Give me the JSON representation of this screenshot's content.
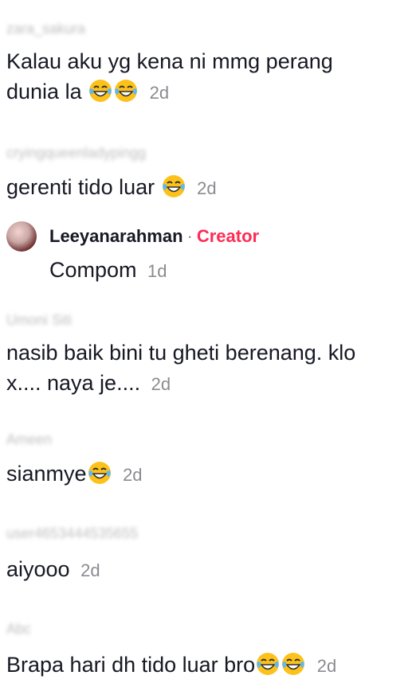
{
  "comments": [
    {
      "username": "zara_sakura",
      "text_line1": "Kalau aku yg kena ni mmg perang",
      "text_line2": "dunia la",
      "emoji": "laugh-cry",
      "time": "2d"
    },
    {
      "username": "cryingqueenladypingg",
      "text": "gerenti tido luar",
      "emoji": "laugh-cry",
      "time": "2d"
    },
    {
      "username": "Umoni Siti",
      "text_line1": "nasib baik bini tu gheti berenang. klo",
      "text_line2": "x.... naya je....",
      "time": "2d"
    },
    {
      "username": "Ameen",
      "text": "sianmye",
      "emoji": "laugh-cry",
      "time": "2d"
    },
    {
      "username": "user4653444535655",
      "text": "aiyooo",
      "time": "2d"
    },
    {
      "username": "Abc",
      "text": "Brapa hari dh tido luar bro",
      "emoji": "laugh-cry",
      "time": "2d"
    }
  ],
  "reply": {
    "username": "Leeyanarahman",
    "separator": "·",
    "badge": "Creator",
    "text": "Compom",
    "time": "1d"
  },
  "colors": {
    "creator_badge": "#fe2c55",
    "timestamp": "#8a8b91",
    "text": "#161823"
  }
}
